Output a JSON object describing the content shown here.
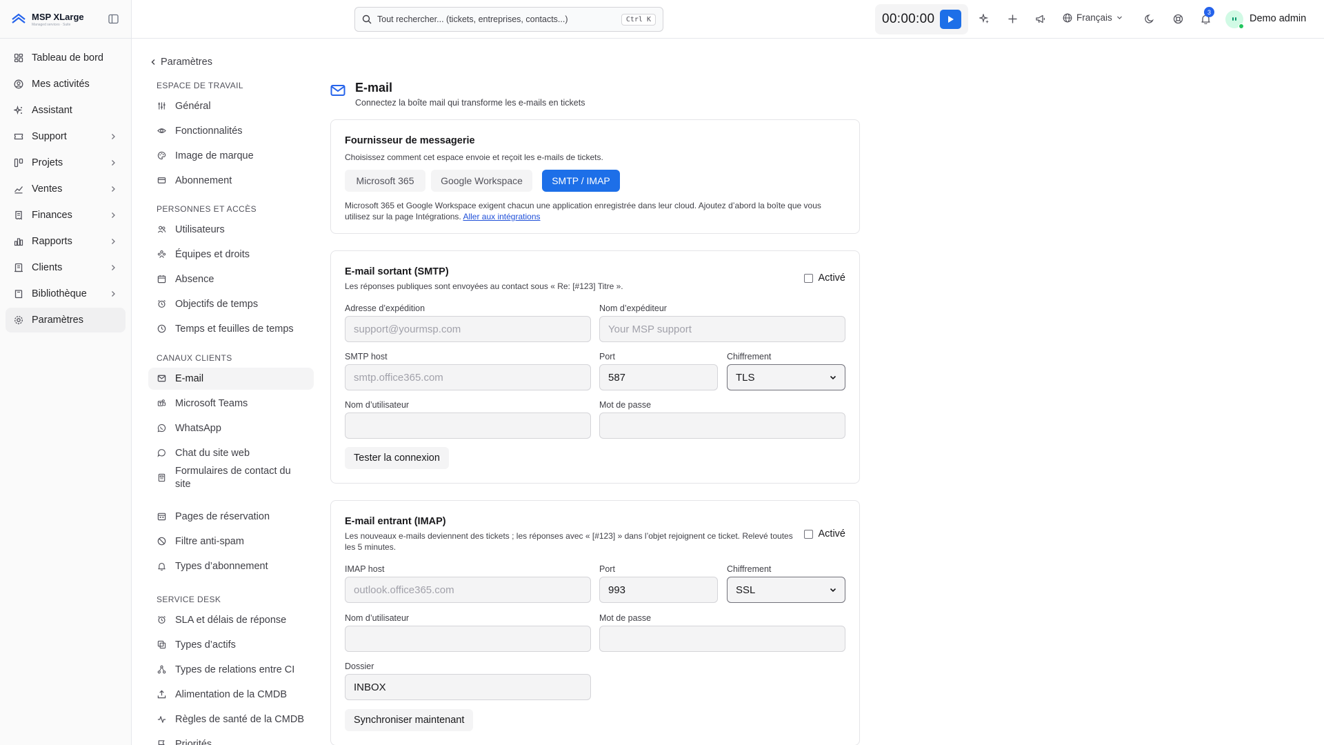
{
  "app": {
    "name": "MSP XLarge",
    "tagline": "Managed services · Suite"
  },
  "nav": {
    "items": [
      {
        "label": "Tableau de bord",
        "icon": "dashboard-icon",
        "chevron": false
      },
      {
        "label": "Mes activités",
        "icon": "user-circle-icon",
        "chevron": false
      },
      {
        "label": "Assistant",
        "icon": "sparkles-icon",
        "chevron": false
      },
      {
        "label": "Support",
        "icon": "ticket-icon",
        "chevron": true
      },
      {
        "label": "Projets",
        "icon": "projects-icon",
        "chevron": true
      },
      {
        "label": "Ventes",
        "icon": "trend-icon",
        "chevron": true
      },
      {
        "label": "Finances",
        "icon": "receipt-icon",
        "chevron": true
      },
      {
        "label": "Rapports",
        "icon": "bar-chart-icon",
        "chevron": true
      },
      {
        "label": "Clients",
        "icon": "building-icon",
        "chevron": true
      },
      {
        "label": "Bibliothèque",
        "icon": "book-icon",
        "chevron": true
      },
      {
        "label": "Paramètres",
        "icon": "gear-icon",
        "chevron": false,
        "active": true
      }
    ]
  },
  "topbar": {
    "search_placeholder": "Tout rechercher... (tickets, entreprises, contacts...)",
    "search_shortcut": "Ctrl K",
    "timer": "00:00:00",
    "language": "Français",
    "notifications_count": "3",
    "user": "Demo admin"
  },
  "settings_nav": {
    "back_label": "Paramètres",
    "sections": [
      {
        "title": "Espace de travail",
        "items": [
          "Général",
          "Fonctionnalités",
          "Image de marque",
          "Abonnement"
        ]
      },
      {
        "title": "Personnes et accès",
        "items": [
          "Utilisateurs",
          "Équipes et droits",
          "Absence",
          "Objectifs de temps",
          "Temps et feuilles de temps"
        ]
      },
      {
        "title": "Canaux clients",
        "items": [
          "E-mail",
          "Microsoft Teams",
          "WhatsApp",
          "Chat du site web",
          "Formulaires de contact du site",
          "Pages de réservation",
          "Filtre anti-spam",
          "Types d’abonnement"
        ]
      },
      {
        "title": "Service desk",
        "items": [
          "SLA et délais de réponse",
          "Types d’actifs",
          "Types de relations entre CI",
          "Alimentation de la CMDB",
          "Règles de santé de la CMDB",
          "Priorités"
        ]
      }
    ],
    "active_item": "E-mail"
  },
  "page": {
    "title": "E-mail",
    "subtitle": "Connectez la boîte mail qui transforme les e-mails en tickets"
  },
  "provider": {
    "title": "Fournisseur de messagerie",
    "description": "Choisissez comment cet espace envoie et reçoit les e-mails de tickets.",
    "options": [
      "Microsoft 365",
      "Google Workspace",
      "SMTP / IMAP"
    ],
    "selected": "SMTP / IMAP",
    "note": "Microsoft 365 et Google Workspace exigent chacun une application enregistrée dans leur cloud. Ajoutez d’abord la boîte que vous utilisez sur la page Intégrations.",
    "note_link": "Aller aux intégrations"
  },
  "smtp": {
    "title": "E-mail sortant (SMTP)",
    "description": "Les réponses publiques sont envoyées au contact sous « Re: [#123] Titre ».",
    "enabled_label": "Activé",
    "from_address_label": "Adresse d’expédition",
    "from_address_placeholder": "support@yourmsp.com",
    "from_name_label": "Nom d’expéditeur",
    "from_name_placeholder": "Your MSP support",
    "host_label": "SMTP host",
    "host_placeholder": "smtp.office365.com",
    "port_label": "Port",
    "port_value": "587",
    "encryption_label": "Chiffrement",
    "encryption_value": "TLS",
    "username_label": "Nom d’utilisateur",
    "password_label": "Mot de passe",
    "test_button": "Tester la connexion"
  },
  "imap": {
    "title": "E-mail entrant (IMAP)",
    "description": "Les nouveaux e-mails deviennent des tickets ; les réponses avec « [#123] » dans l’objet rejoignent ce ticket. Relevé toutes les 5 minutes.",
    "enabled_label": "Activé",
    "host_label": "IMAP host",
    "host_placeholder": "outlook.office365.com",
    "port_label": "Port",
    "port_value": "993",
    "encryption_label": "Chiffrement",
    "encryption_value": "SSL",
    "username_label": "Nom d’utilisateur",
    "password_label": "Mot de passe",
    "folder_label": "Dossier",
    "folder_value": "INBOX",
    "sync_button": "Synchroniser maintenant"
  },
  "colors": {
    "accent": "#1d6fe8",
    "border": "#e4e4e7",
    "muted_bg": "#f4f4f5"
  }
}
